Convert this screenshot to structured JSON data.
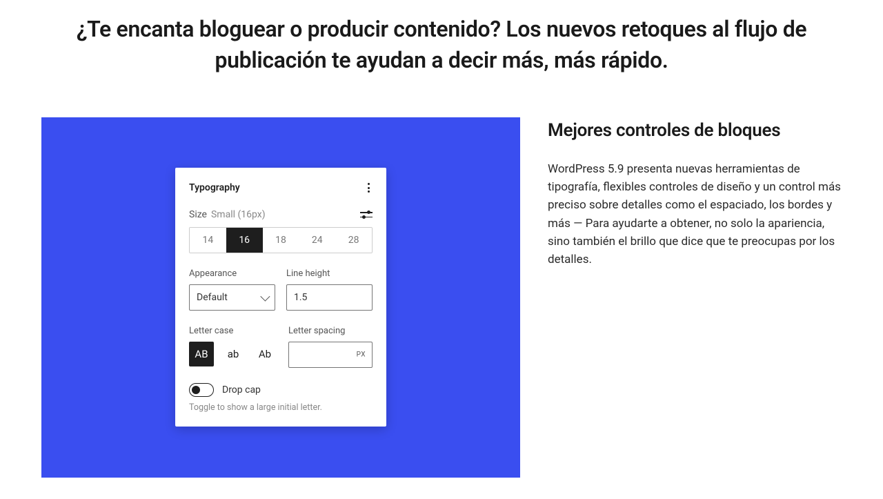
{
  "headline": "¿Te encanta bloguear o producir contenido? Los nuevos retoques al flujo de publicación te ayudan a decir más, más rápido.",
  "panel": {
    "title": "Typography",
    "size": {
      "label": "Size",
      "current": "Small (16px)",
      "options": [
        "14",
        "16",
        "18",
        "24",
        "28"
      ],
      "active_index": 1
    },
    "appearance": {
      "label": "Appearance",
      "value": "Default"
    },
    "line_height": {
      "label": "Line height",
      "value": "1.5"
    },
    "letter_case": {
      "label": "Letter case",
      "options": [
        "AB",
        "ab",
        "Ab"
      ],
      "active_index": 0
    },
    "letter_spacing": {
      "label": "Letter spacing",
      "value": "",
      "unit": "PX"
    },
    "drop_cap": {
      "label": "Drop cap",
      "help": "Toggle to show a large initial letter."
    }
  },
  "description": {
    "title": "Mejores controles de bloques",
    "body": "WordPress 5.9 presenta nuevas herramientas de tipografía, flexibles controles de diseño y un control más preciso sobre detalles como el espaciado, los bordes y más — Para ayudarte a obtener, no solo la apariencia, sino también el brillo que dice que te preocupas por los detalles."
  }
}
